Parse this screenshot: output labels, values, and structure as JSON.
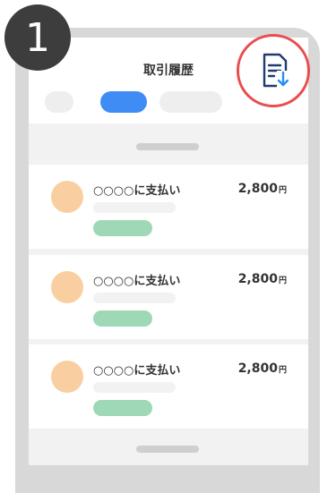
{
  "step": {
    "number": "1"
  },
  "header": {
    "title": "取引履歴"
  },
  "tabs": [
    {
      "active": false
    },
    {
      "active": true
    },
    {
      "active": false
    }
  ],
  "transactions": [
    {
      "title": "○○○○に支払い",
      "amount": "2,800",
      "currency": "円"
    },
    {
      "title": "○○○○に支払い",
      "amount": "2,800",
      "currency": "円"
    },
    {
      "title": "○○○○に支払い",
      "amount": "2,800",
      "currency": "円"
    }
  ],
  "icons": {
    "download": "document-download-icon"
  },
  "colors": {
    "accent": "#3f8cf5",
    "highlight": "#ea4d4f",
    "avatar": "#f9cfa2",
    "pill": "#9fd8b7",
    "frame": "#d8d8d8",
    "badge": "#3d3d3d"
  }
}
